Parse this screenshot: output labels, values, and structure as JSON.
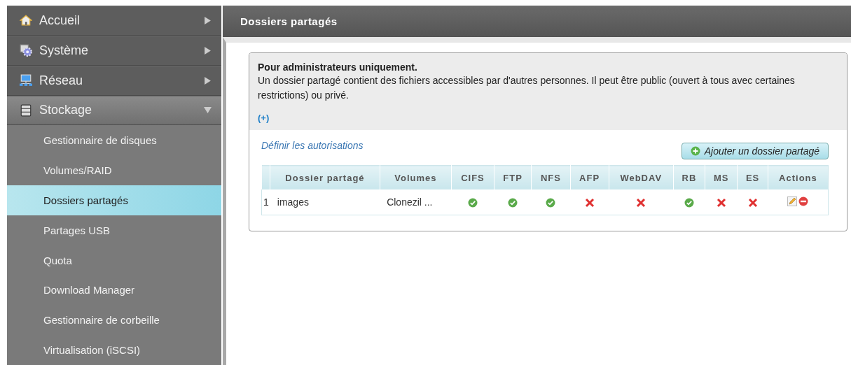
{
  "sidebar": {
    "items": [
      {
        "label": "Accueil",
        "expanded": false
      },
      {
        "label": "Système",
        "expanded": false
      },
      {
        "label": "Réseau",
        "expanded": false
      },
      {
        "label": "Stockage",
        "expanded": true,
        "children": [
          {
            "label": "Gestionnaire de disques",
            "selected": false
          },
          {
            "label": "Volumes/RAID",
            "selected": false
          },
          {
            "label": "Dossiers partagés",
            "selected": true
          },
          {
            "label": "Partages USB",
            "selected": false
          },
          {
            "label": "Quota",
            "selected": false
          },
          {
            "label": "Download Manager",
            "selected": false
          },
          {
            "label": "Gestionnaire de corbeille",
            "selected": false
          },
          {
            "label": "Virtualisation (iSCSI)",
            "selected": false
          }
        ]
      }
    ]
  },
  "page_title": "Dossiers partagés",
  "info": {
    "heading": "Pour administrateurs uniquement.",
    "text": "Un dossier partagé contient des fichiers accessibles par d'autres personnes. Il peut être public (ouvert à tous avec certaines restrictions) ou privé.",
    "more_link": "(+)"
  },
  "permissions_link": "Définir les autorisations",
  "add_button": "Ajouter un dossier partagé",
  "table": {
    "columns": [
      "Dossier partagé",
      "Volumes",
      "CIFS",
      "FTP",
      "NFS",
      "AFP",
      "WebDAV",
      "RB",
      "MS",
      "ES",
      "Actions"
    ],
    "rows": [
      {
        "index": "1",
        "name": "images",
        "volume": "Clonezil ...",
        "protocols": [
          true,
          true,
          true,
          false,
          false,
          true,
          false,
          false
        ]
      }
    ]
  }
}
